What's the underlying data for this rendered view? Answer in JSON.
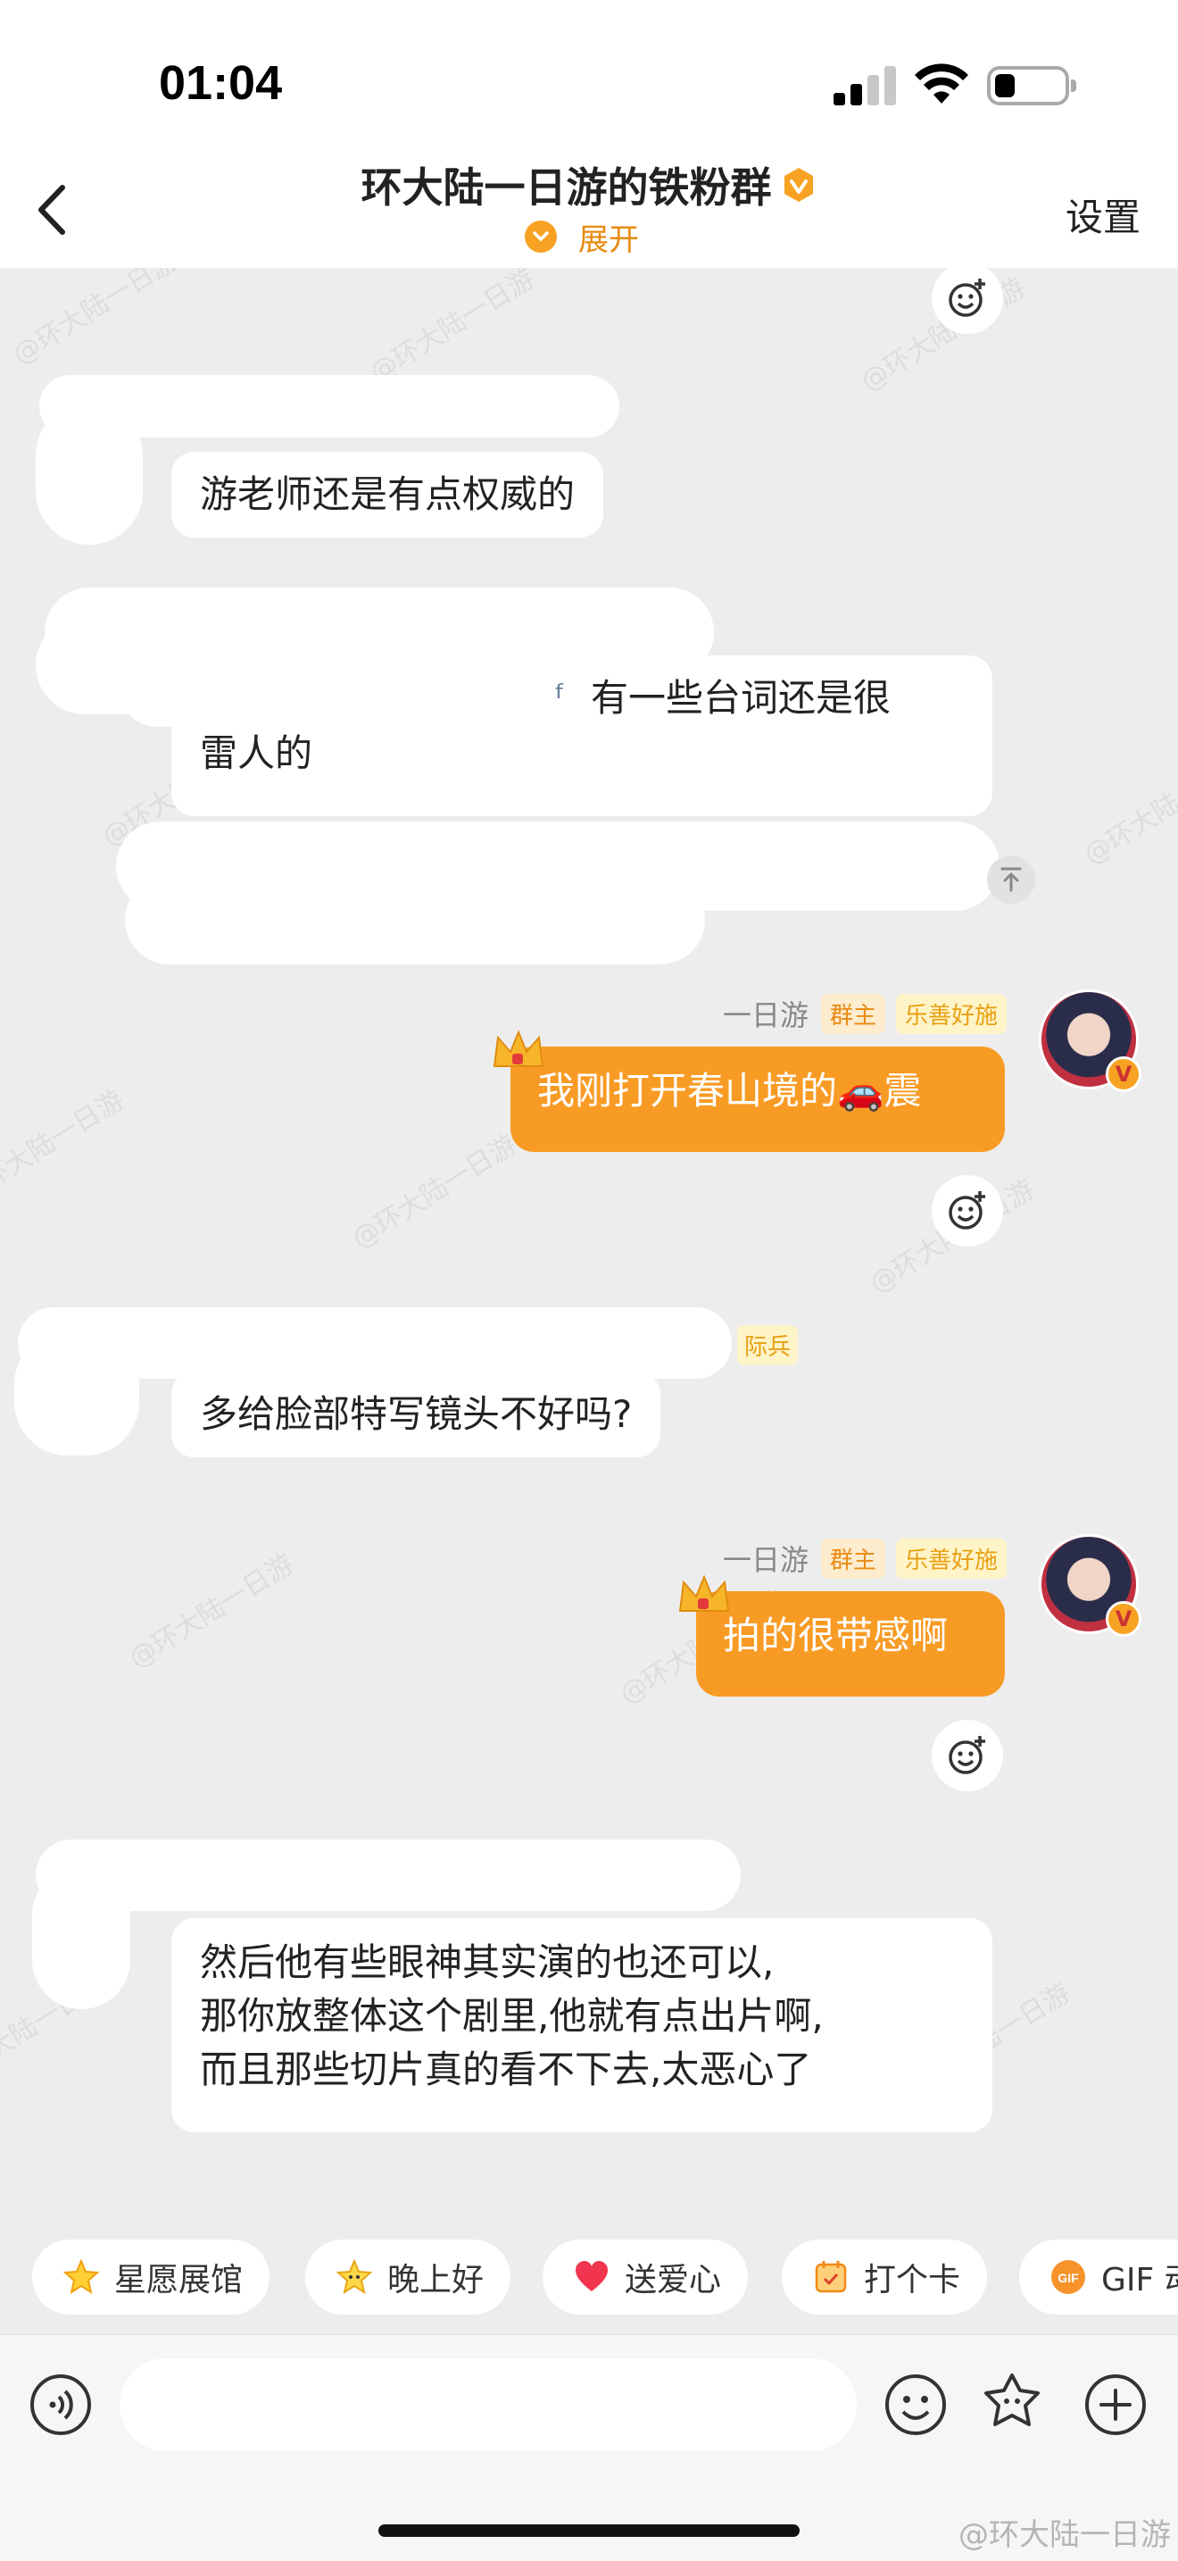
{
  "status_bar": {
    "time": "01:04"
  },
  "header": {
    "title": "环大陆一日游的铁粉群",
    "expand_label": "展开",
    "settings_label": "设置"
  },
  "messages": [
    {
      "side": "other",
      "text": "游老师还是有点权威的"
    },
    {
      "side": "other",
      "fragment": "有一些台词还是很",
      "line2": "雷人的"
    },
    {
      "side": "me",
      "sender": "一日游",
      "tags": [
        "群主",
        "乐善好施"
      ],
      "text": "我刚打开春山境的",
      "emoji": "🚗",
      "text_after": "震"
    },
    {
      "side": "other",
      "partial_tag": "际兵",
      "text": "多给脸部特写镜头不好吗?"
    },
    {
      "side": "me",
      "sender": "一日游",
      "tags": [
        "群主",
        "乐善好施"
      ],
      "text": "拍的很带感啊"
    },
    {
      "side": "other",
      "lines": [
        "然后他有些眼神其实演的也还可以,",
        "那你放整体这个剧里,他就有点出片啊,",
        "而且那些切片真的看不下去,太恶心了"
      ]
    }
  ],
  "quick_replies": [
    {
      "label": "星愿展馆",
      "icon": "star-icon"
    },
    {
      "label": "晚上好",
      "icon": "star-face-icon"
    },
    {
      "label": "送爱心",
      "icon": "heart-icon"
    },
    {
      "label": "打个卡",
      "icon": "checkin-icon"
    },
    {
      "label": "GIF 动",
      "icon": "gif-icon"
    }
  ],
  "footer_watermark": "@环大陆一日游",
  "colors": {
    "accent": "#f89b25",
    "background": "#ededed"
  }
}
